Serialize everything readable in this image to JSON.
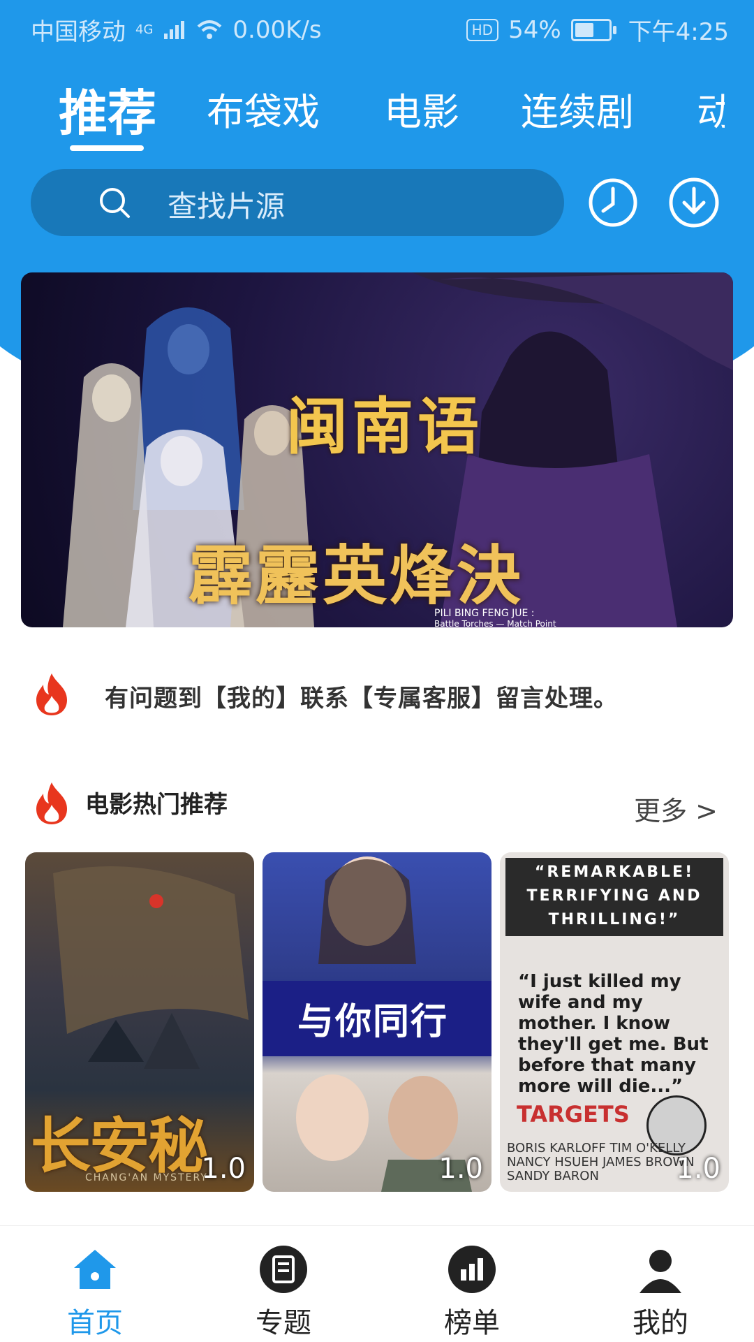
{
  "status_bar": {
    "carrier": "中国移动",
    "network": "4G",
    "speed": "0.00K/s",
    "hd": "HD",
    "battery": "54%",
    "time": "下午4:25"
  },
  "tabs": [
    {
      "label": "推荐",
      "active": true
    },
    {
      "label": "布袋戏",
      "active": false
    },
    {
      "label": "电影",
      "active": false
    },
    {
      "label": "连续剧",
      "active": false
    },
    {
      "label": "动",
      "active": false
    }
  ],
  "search": {
    "placeholder": "查找片源"
  },
  "banner": {
    "title1": "闽南语",
    "title2": "霹靂英烽決",
    "subtitle1": "PILI BING FENG JUE :",
    "subtitle2": "Battle Torches — Match Point"
  },
  "notice": {
    "text": "有问题到【我的】联系【专属客服】留言处理。"
  },
  "section": {
    "title": "电影热门推荐",
    "more": "更多 >"
  },
  "movies": [
    {
      "poster_text": "长安秘闻",
      "poster_sub": "CHANG'AN MYSTERY",
      "rating": "1.0"
    },
    {
      "poster_text": "与你同行",
      "rating": "1.0"
    },
    {
      "poster_head": "“REMARKABLE! TERRIFYING AND THRILLING!”",
      "poster_quote": "“I just killed my wife and my mother. I know they'll get me. But before that many more will die...”",
      "poster_brand": "TARGETS",
      "poster_credits": "BORIS KARLOFF   TIM O'KELLY   NANCY HSUEH   JAMES BROWN   SANDY BARON",
      "rating": "1.0"
    }
  ],
  "bottom_nav": [
    {
      "label": "首页",
      "icon": "home-icon",
      "active": true
    },
    {
      "label": "专题",
      "icon": "topic-icon",
      "active": false
    },
    {
      "label": "榜单",
      "icon": "chart-icon",
      "active": false
    },
    {
      "label": "我的",
      "icon": "person-icon",
      "active": false
    }
  ],
  "colors": {
    "primary": "#1f98ea",
    "search_bg": "#1878b9",
    "fire": "#e8361e"
  }
}
